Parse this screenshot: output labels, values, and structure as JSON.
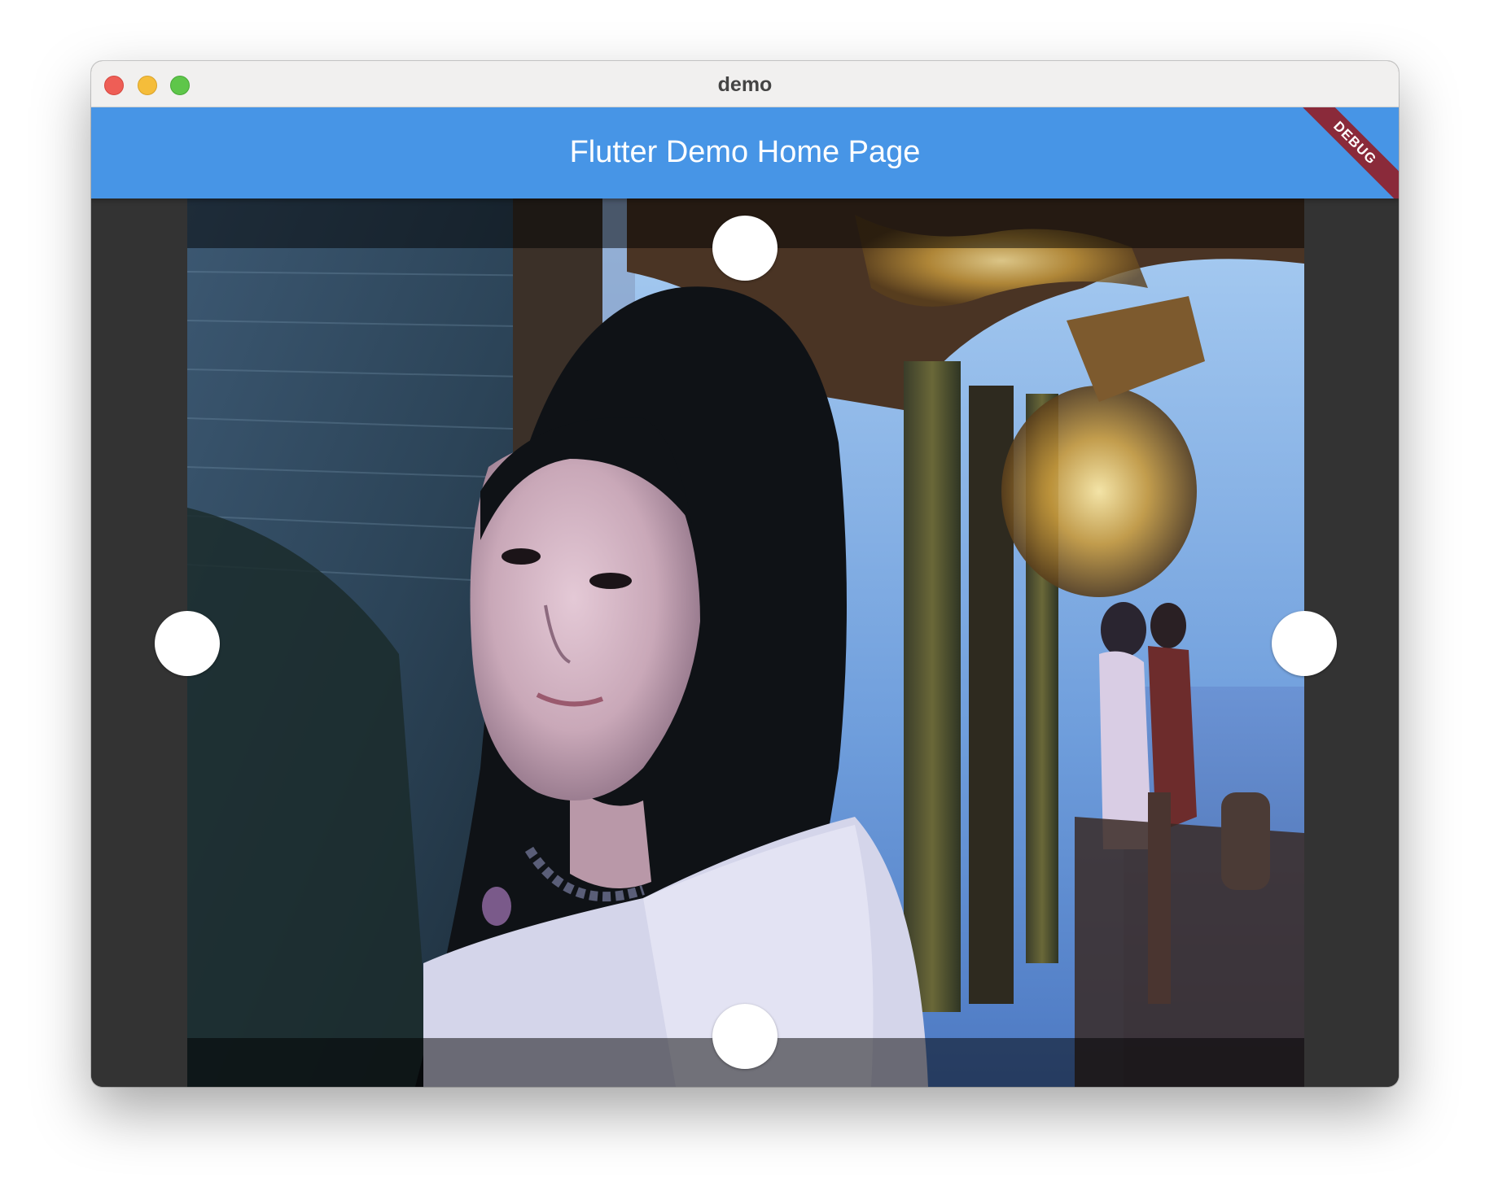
{
  "window": {
    "title": "demo",
    "controls": [
      "close",
      "minimize",
      "maximize"
    ]
  },
  "appbar": {
    "title": "Flutter Demo Home Page",
    "color": "#4795e6",
    "debug_banner": "DEBUG",
    "debug_banner_color": "#8a2a3a"
  },
  "crop_editor": {
    "background_color": "#333333",
    "handles": [
      "top",
      "right",
      "bottom",
      "left"
    ],
    "image_icon": "photo-woman-on-balcony"
  }
}
